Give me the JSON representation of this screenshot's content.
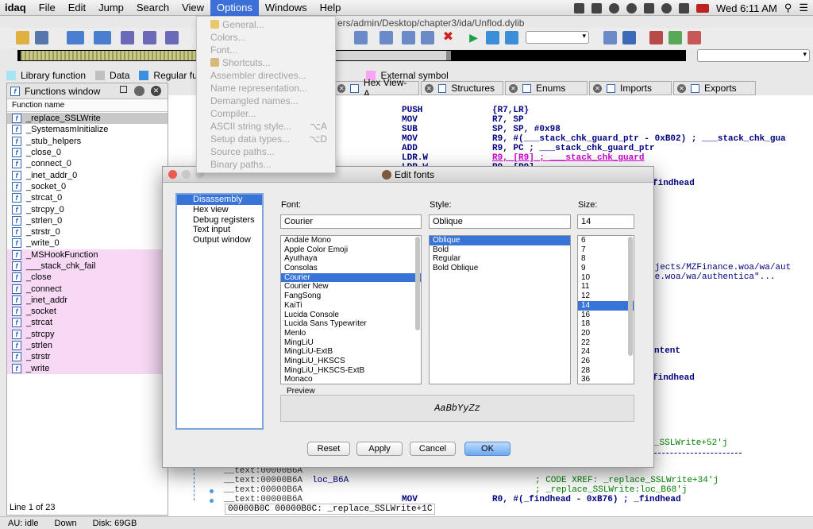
{
  "menubar": {
    "app": "idaq",
    "items": [
      "File",
      "Edit",
      "Jump",
      "Search",
      "View",
      "Options",
      "Windows",
      "Help"
    ],
    "clock": "Wed 6:11 AM",
    "path_fragment": "ers/admin/Desktop/chapter3/ida/Unflod.dylib"
  },
  "legend": {
    "items": [
      {
        "label": "Library function",
        "color": "#a6e4f4"
      },
      {
        "label": "Data",
        "color": "#c0c0c0"
      },
      {
        "label": "Regular func",
        "color": "#3b8fe0"
      },
      {
        "label": "External symbol",
        "color": "#f9a4f4"
      }
    ]
  },
  "functions_window": {
    "title": "Functions window",
    "column": "Function name",
    "items": [
      {
        "name": "_replace_SSLWrite",
        "kind": "sel"
      },
      {
        "name": "_SystemasmInitialize",
        "kind": "reg"
      },
      {
        "name": "_stub_helpers",
        "kind": "reg"
      },
      {
        "name": "_close_0",
        "kind": "reg"
      },
      {
        "name": "_connect_0",
        "kind": "reg"
      },
      {
        "name": "_inet_addr_0",
        "kind": "reg"
      },
      {
        "name": "_socket_0",
        "kind": "reg"
      },
      {
        "name": "_strcat_0",
        "kind": "reg"
      },
      {
        "name": "_strcpy_0",
        "kind": "reg"
      },
      {
        "name": "_strlen_0",
        "kind": "reg"
      },
      {
        "name": "_strstr_0",
        "kind": "reg"
      },
      {
        "name": "_write_0",
        "kind": "reg"
      },
      {
        "name": "_MSHookFunction",
        "kind": "imp"
      },
      {
        "name": "___stack_chk_fail",
        "kind": "imp"
      },
      {
        "name": "_close",
        "kind": "imp"
      },
      {
        "name": "_connect",
        "kind": "imp"
      },
      {
        "name": "_inet_addr",
        "kind": "imp"
      },
      {
        "name": "_socket",
        "kind": "imp"
      },
      {
        "name": "_strcat",
        "kind": "imp"
      },
      {
        "name": "_strcpy",
        "kind": "imp"
      },
      {
        "name": "_strlen",
        "kind": "imp"
      },
      {
        "name": "_strstr",
        "kind": "imp"
      },
      {
        "name": "_write",
        "kind": "imp"
      }
    ],
    "line_status": "Line 1 of 23"
  },
  "status": {
    "au": "AU:",
    "state": "idle",
    "dir": "Down",
    "disk": "Disk: 69GB"
  },
  "tabs": [
    "Hex View-A",
    "Structures",
    "Enums",
    "Imports",
    "Exports"
  ],
  "disasm": {
    "lines": [
      {
        "mn": "PUSH",
        "op": "{R7,LR}"
      },
      {
        "mn": "MOV",
        "op": "R7, SP"
      },
      {
        "mn": "SUB",
        "op": "SP, SP, #0x98"
      },
      {
        "mn": "MOV",
        "op": "R9, #(___stack_chk_guard_ptr - 0xB02) ; ___stack_chk_gua"
      },
      {
        "mn": "ADD",
        "op": "R9, PC ; ___stack_chk_guard_ptr"
      },
      {
        "mn": "LDR.W",
        "op": "R9, [R9] ; ___stack_chk_guard"
      },
      {
        "mn": "LDR.W",
        "op": "R9, [R9]"
      }
    ],
    "right_fragments": [
      "findhead",
      "ojects/MZFinance.woa/wa/aut",
      "ce.woa/wa/authentica\"...",
      "ntent",
      "findhead",
      "_SSLWrite+52'j"
    ],
    "bottom_lines": [
      {
        "addr": "__text:00000B6A",
        "text": ""
      },
      {
        "addr": "__text:00000B6A",
        "text": "loc_B6A",
        "comment": "; CODE XREF: _replace_SSLWrite+34'j"
      },
      {
        "addr": "__text:00000B6A",
        "text": "",
        "comment": "; _replace_SSLWrite:loc_B68'j"
      },
      {
        "addr": "__text:00000B6A",
        "text": "MOV",
        "op": "R0, #(_findhead - 0xB76) ; _findhead"
      }
    ],
    "sync": "00000B0C  00000B0C: _replace_SSLWrite+1C"
  },
  "options_menu": {
    "items": [
      {
        "label": "General...",
        "shortcut": "",
        "icon": "general-icon"
      },
      {
        "label": "Colors...",
        "shortcut": ""
      },
      {
        "label": "Font...",
        "shortcut": ""
      },
      {
        "label": "Shortcuts...",
        "shortcut": "",
        "icon": "shortcuts-icon"
      },
      {
        "label": "Assembler directives...",
        "shortcut": ""
      },
      {
        "label": "Name representation...",
        "shortcut": ""
      },
      {
        "label": "Demangled names...",
        "shortcut": ""
      },
      {
        "label": "Compiler...",
        "shortcut": ""
      },
      {
        "label": "ASCII string style...",
        "shortcut": "⌥A"
      },
      {
        "label": "Setup data types...",
        "shortcut": "⌥D"
      },
      {
        "label": "Source paths...",
        "shortcut": ""
      },
      {
        "label": "Binary paths...",
        "shortcut": ""
      }
    ]
  },
  "dialog": {
    "title": "Edit fonts",
    "categories": [
      "Disassembly",
      "Hex view",
      "Debug registers",
      "Text input",
      "Output window"
    ],
    "font_label": "Font:",
    "style_label": "Style:",
    "size_label": "Size:",
    "font_value": "Courier",
    "style_value": "Oblique",
    "size_value": "14",
    "fonts": [
      "Andale Mono",
      "Apple Color Emoji",
      "Ayuthaya",
      "Consolas",
      "Courier",
      "Courier New",
      "FangSong",
      "KaiTi",
      "Lucida Console",
      "Lucida Sans Typewriter",
      "Menlo",
      "MingLiU",
      "MingLiU-ExtB",
      "MingLiU_HKSCS",
      "MingLiU_HKSCS-ExtB",
      "Monaco"
    ],
    "styles": [
      "Oblique",
      "Bold",
      "Regular",
      "Bold Oblique"
    ],
    "sizes": [
      "6",
      "7",
      "8",
      "9",
      "10",
      "11",
      "12",
      "14",
      "16",
      "18",
      "20",
      "22",
      "24",
      "26",
      "28",
      "36"
    ],
    "preview_label": "Preview",
    "preview_text": "AaBbYyZz",
    "buttons": {
      "reset": "Reset",
      "apply": "Apply",
      "cancel": "Cancel",
      "ok": "OK"
    }
  }
}
